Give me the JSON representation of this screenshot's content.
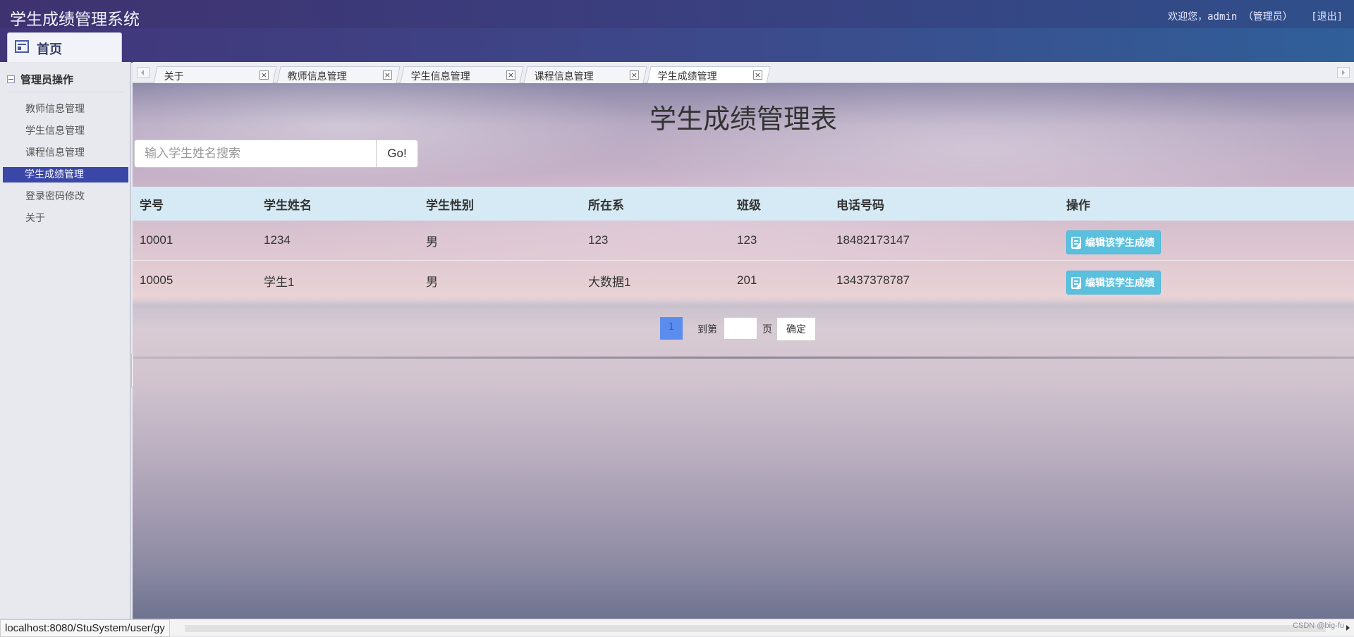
{
  "header": {
    "app_title": "学生成绩管理系统",
    "welcome": "欢迎您，admin （管理员）",
    "logout": "[退出]"
  },
  "nav": {
    "home_tab": "首页"
  },
  "sidebar": {
    "group_title": "管理员操作",
    "items": [
      {
        "label": "教师信息管理"
      },
      {
        "label": "学生信息管理"
      },
      {
        "label": "课程信息管理"
      },
      {
        "label": "学生成绩管理",
        "active": true
      },
      {
        "label": "登录密码修改"
      },
      {
        "label": "关于"
      }
    ]
  },
  "tabs": [
    {
      "label": "关于"
    },
    {
      "label": "教师信息管理"
    },
    {
      "label": "学生信息管理"
    },
    {
      "label": "课程信息管理"
    },
    {
      "label": "学生成绩管理",
      "active": true
    }
  ],
  "main": {
    "title": "学生成绩管理表",
    "search_placeholder": "输入学生姓名搜索",
    "search_value": "",
    "go_label": "Go!",
    "table": {
      "columns": [
        "学号",
        "学生姓名",
        "学生性别",
        "所在系",
        "班级",
        "电话号码",
        "操作"
      ],
      "rows": [
        [
          "10001",
          "1234",
          "男",
          "123",
          "123",
          "18482173147"
        ],
        [
          "10005",
          "学生1",
          "男",
          "大数据1",
          "201",
          "13437378787"
        ]
      ],
      "action_label": "编辑该学生成绩"
    },
    "pager": {
      "current_page": "1",
      "goto_label": "到第",
      "page_input_value": "",
      "page_unit": "页",
      "confirm_label": "确定"
    }
  },
  "statusbar": {
    "url": "localhost:8080/StuSystem/user/gy",
    "watermark": "CSDN @big-fu"
  },
  "colors": {
    "accent": "#3a47a6",
    "table_header": "#d6eaf5",
    "action_button": "#5bc0de",
    "current_page": "#5b8def"
  },
  "icons": [
    "home-icon",
    "collapse-minus-icon",
    "tab-close-icon",
    "edit-icon",
    "scroll-left-icon",
    "scroll-right-icon",
    "sidebar-collapse-icon"
  ]
}
